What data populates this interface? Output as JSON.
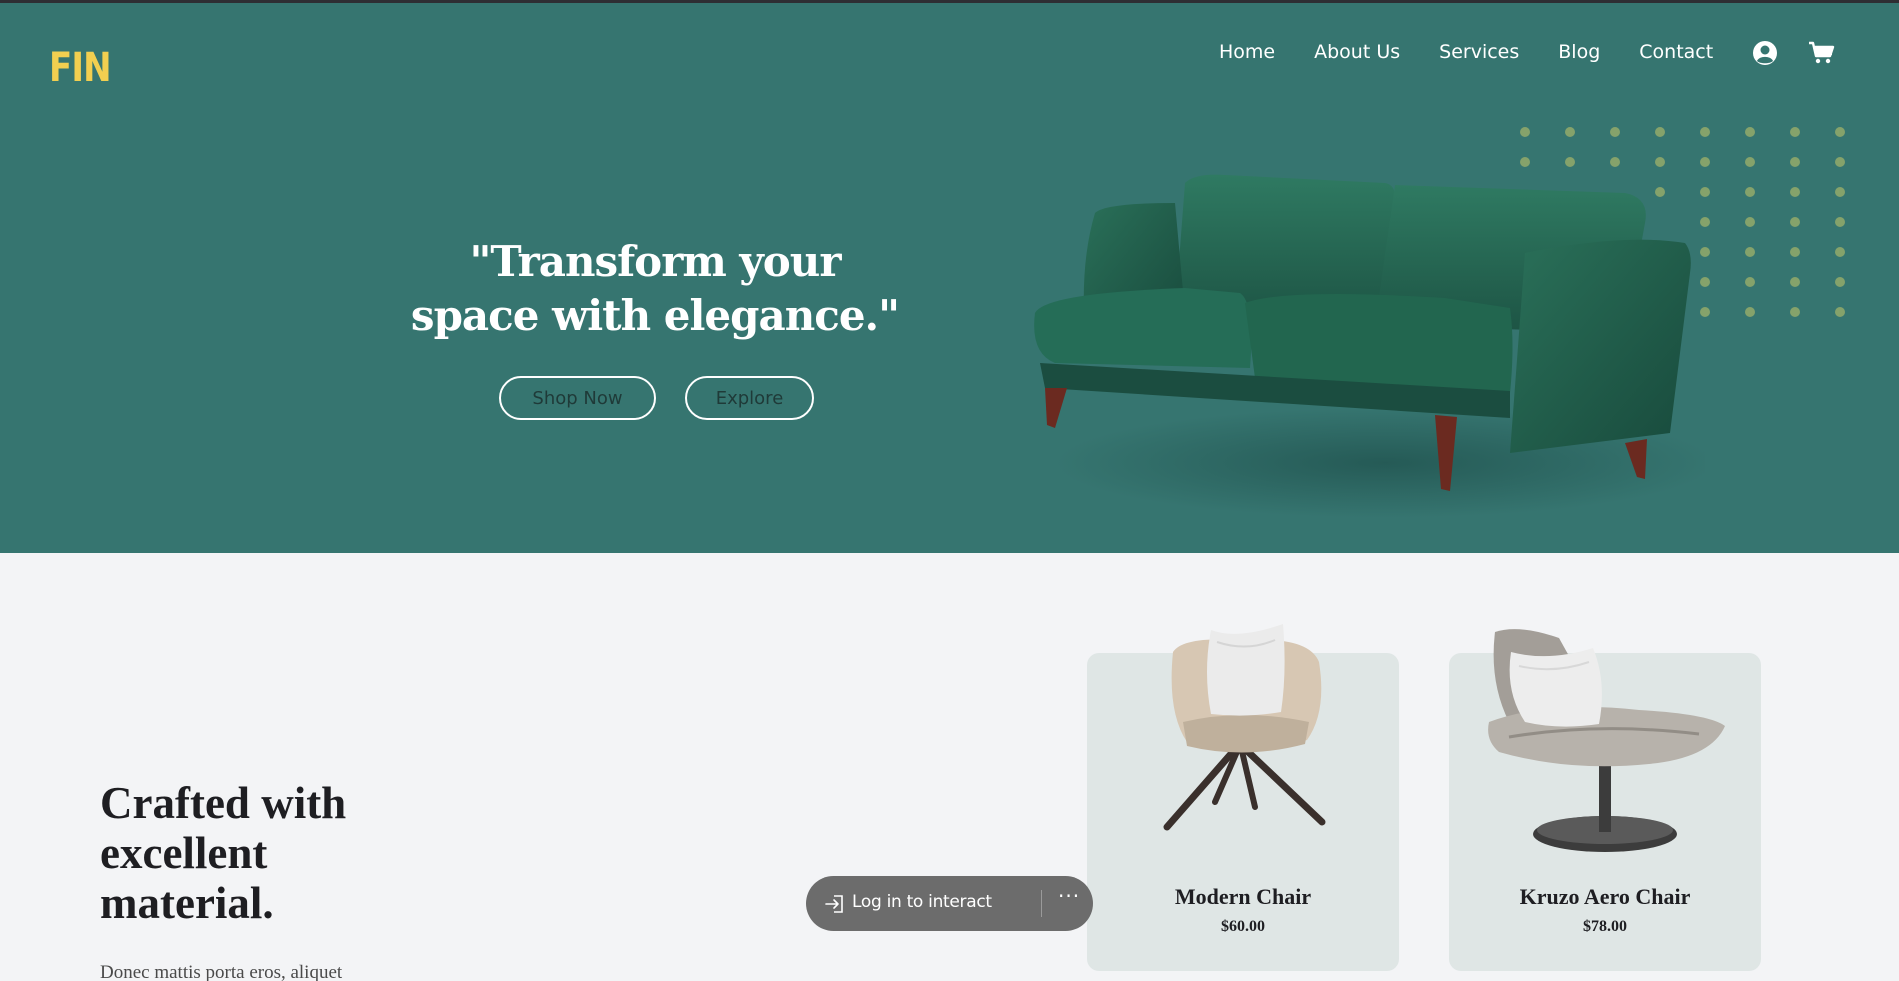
{
  "brand": {
    "logo_text": "FIN",
    "logo_color": "#f2cf50",
    "hero_bg": "#367570"
  },
  "nav": {
    "items": [
      {
        "label": "Home"
      },
      {
        "label": "About Us"
      },
      {
        "label": "Services"
      },
      {
        "label": "Blog"
      },
      {
        "label": "Contact"
      }
    ],
    "user_icon": "user-icon",
    "cart_icon": "cart-icon"
  },
  "hero": {
    "headline": "\"Transform your space with elegance.\"",
    "shop_label": "Shop Now",
    "explore_label": "Explore",
    "image": "green-velvet-sofa"
  },
  "feature": {
    "title": "Crafted with excellent material.",
    "body": "Donec mattis porta eros, aliquet"
  },
  "products": [
    {
      "name": "Modern Chair",
      "price": "$60.00",
      "image": "beige-armchair-with-pillow"
    },
    {
      "name": "Kruzo Aero Chair",
      "price": "$78.00",
      "image": "grey-lounge-chair-with-pillow"
    }
  ],
  "overlay": {
    "login_label": "Log in to interact",
    "login_icon": "login-icon",
    "more_icon": "more-icon",
    "more_glyph": "···"
  }
}
